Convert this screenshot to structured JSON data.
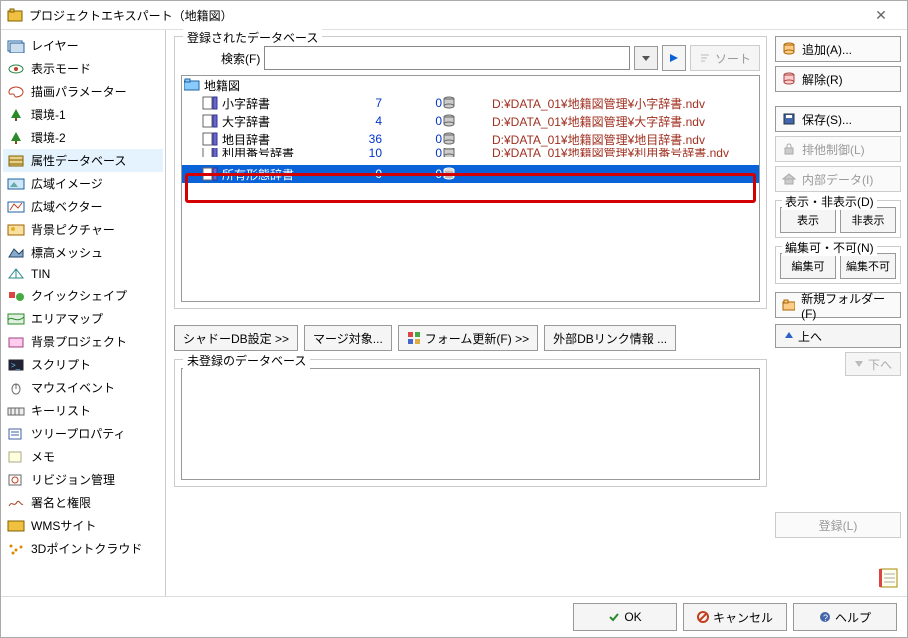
{
  "window": {
    "title": "プロジェクトエキスパート（地籍図）"
  },
  "sidebar": {
    "items": [
      {
        "label": "レイヤー"
      },
      {
        "label": "表示モード"
      },
      {
        "label": "描画パラメーター"
      },
      {
        "label": "環境-1"
      },
      {
        "label": "環境-2"
      },
      {
        "label": "属性データベース",
        "selected": true
      },
      {
        "label": "広域イメージ"
      },
      {
        "label": "広域ベクター"
      },
      {
        "label": "背景ピクチャー"
      },
      {
        "label": "標高メッシュ"
      },
      {
        "label": "TIN"
      },
      {
        "label": "クイックシェイプ"
      },
      {
        "label": "エリアマップ"
      },
      {
        "label": "背景プロジェクト"
      },
      {
        "label": "スクリプト"
      },
      {
        "label": "マウスイベント"
      },
      {
        "label": "キーリスト"
      },
      {
        "label": "ツリープロパティ"
      },
      {
        "label": "メモ"
      },
      {
        "label": "リビジョン管理"
      },
      {
        "label": "署名と権限"
      },
      {
        "label": "WMSサイト"
      },
      {
        "label": "3Dポイントクラウド"
      }
    ]
  },
  "registered": {
    "legend": "登録されたデータベース",
    "search_label": "検索(F)",
    "search_value": "",
    "sort_label": "ソート",
    "root": "地籍図",
    "rows": [
      {
        "name": "小字辞書",
        "v1": "7",
        "v2": "0",
        "path": "D:¥DATA_01¥地籍図管理¥小字辞書.ndv"
      },
      {
        "name": "大字辞書",
        "v1": "4",
        "v2": "0",
        "path": "D:¥DATA_01¥地籍図管理¥大字辞書.ndv"
      },
      {
        "name": "地目辞書",
        "v1": "36",
        "v2": "0",
        "path": "D:¥DATA_01¥地籍図管理¥地目辞書.ndv"
      },
      {
        "name": "利用番号辞書",
        "v1": "10",
        "v2": "0",
        "path": "D:¥DATA_01¥地籍図管理¥利用番号辞書.ndv"
      },
      {
        "name": "所有形態辞書",
        "v1": "0",
        "v2": "0",
        "path": "",
        "selected": true
      }
    ]
  },
  "buttons_row": {
    "shadow": "シャドーDB設定 >>",
    "merge": "マージ対象...",
    "form": "フォーム更新(F) >>",
    "extdb": "外部DBリンク情報 ..."
  },
  "unregistered": {
    "legend": "未登録のデータベース"
  },
  "right": {
    "add": "追加(A)...",
    "remove": "解除(R)",
    "save": "保存(S)...",
    "exclusive": "排他制御(L)",
    "internal": "内部データ(I)",
    "vis_legend": "表示・非表示(D)",
    "show": "表示",
    "hide": "非表示",
    "edit_legend": "編集可・不可(N)",
    "editable": "編集可",
    "readonly": "編集不可",
    "newfolder": "新規フォルダー(F)",
    "up": "上へ",
    "down": "下へ",
    "register": "登録(L)"
  },
  "footer": {
    "ok": "OK",
    "cancel": "キャンセル",
    "help": "ヘルプ"
  }
}
